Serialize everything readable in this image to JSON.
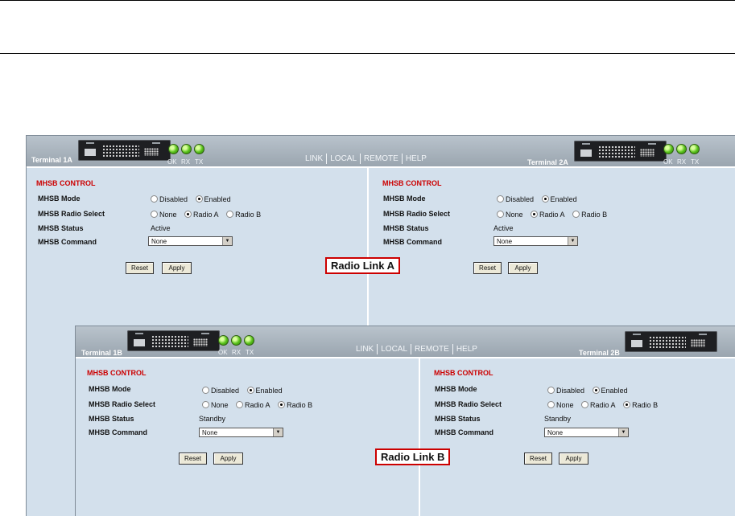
{
  "nav_items": [
    "LINK",
    "LOCAL",
    "REMOTE",
    "HELP"
  ],
  "led_labels": [
    "OK",
    "RX",
    "TX"
  ],
  "field_labels": {
    "mode": "MHSB Mode",
    "radio_select": "MHSB Radio Select",
    "status": "MHSB Status",
    "command": "MHSB Command"
  },
  "option_labels": {
    "disabled": "Disabled",
    "enabled": "Enabled",
    "none": "None",
    "radio_a": "Radio A",
    "radio_b": "Radio B"
  },
  "buttons": {
    "reset": "Reset",
    "apply": "Apply"
  },
  "panel_a": {
    "callout": "Radio Link A",
    "left": {
      "terminal": "Terminal 1A",
      "section_title": "MHSB CONTROL",
      "mode_selected": "Enabled",
      "radio_selected": "Radio A",
      "status_value": "Active",
      "command_value": "None"
    },
    "right": {
      "terminal": "Terminal 2A",
      "section_title": "MHSB CONTROL",
      "mode_selected": "Enabled",
      "radio_selected": "Radio A",
      "status_value": "Active",
      "command_value": "None"
    }
  },
  "panel_b": {
    "callout": "Radio Link B",
    "left": {
      "terminal": "Terminal 1B",
      "section_title": "MHSB CONTROL",
      "mode_selected": "Enabled",
      "radio_selected": "Radio B",
      "status_value": "Standby",
      "command_value": "None"
    },
    "right": {
      "terminal": "Terminal 2B",
      "section_title": "MHSB CONTROL",
      "mode_selected": "Enabled",
      "radio_selected": "Radio B",
      "status_value": "Standby",
      "command_value": "None"
    }
  },
  "colors": {
    "panel_bg": "#d3e0ec",
    "header_bg": "#a9b4be",
    "section_title": "#cc0000",
    "callout_border": "#cc0000",
    "led_on": "#58c11b"
  }
}
